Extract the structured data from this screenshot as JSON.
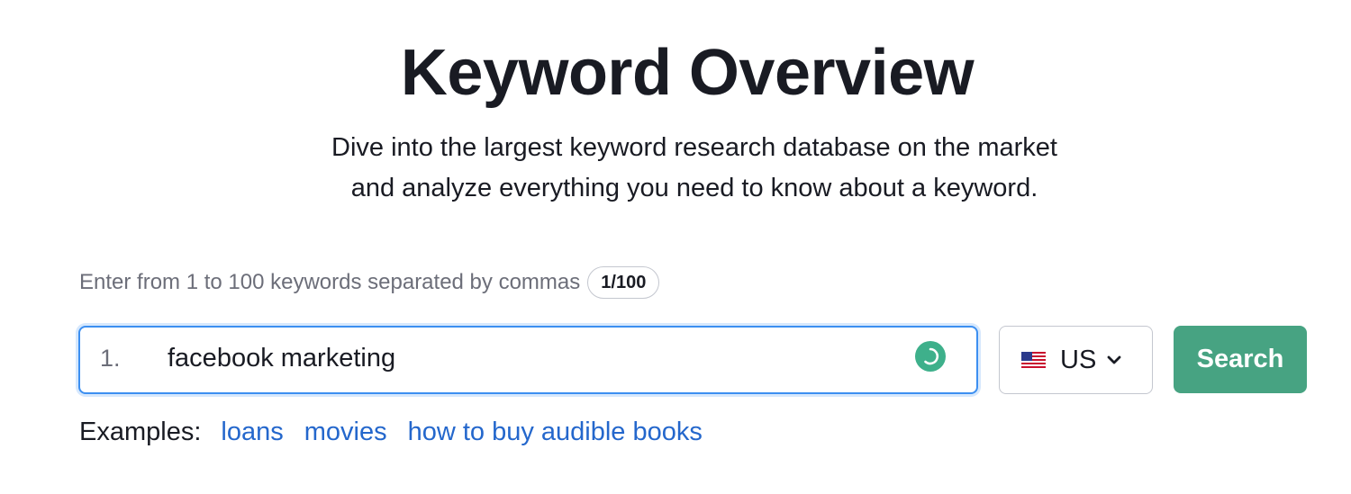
{
  "header": {
    "title": "Keyword Overview",
    "subtitle_line1": "Dive into the largest keyword research database on the market",
    "subtitle_line2": "and analyze everything you need to know about a keyword."
  },
  "form": {
    "hint": "Enter from 1 to 100 keywords separated by commas",
    "counter": "1/100",
    "line_number": "1.",
    "keyword_value": "facebook marketing",
    "database": {
      "selected": "US",
      "flag_icon": "us-flag-icon"
    },
    "search_label": "Search"
  },
  "examples": {
    "label": "Examples:",
    "links": [
      "loans",
      "movies",
      "how to buy audible books"
    ]
  },
  "colors": {
    "accent_green": "#47a382",
    "link_blue": "#2467cc",
    "focus_blue": "#3c8ff1",
    "spinner_green": "#3eb08b"
  }
}
